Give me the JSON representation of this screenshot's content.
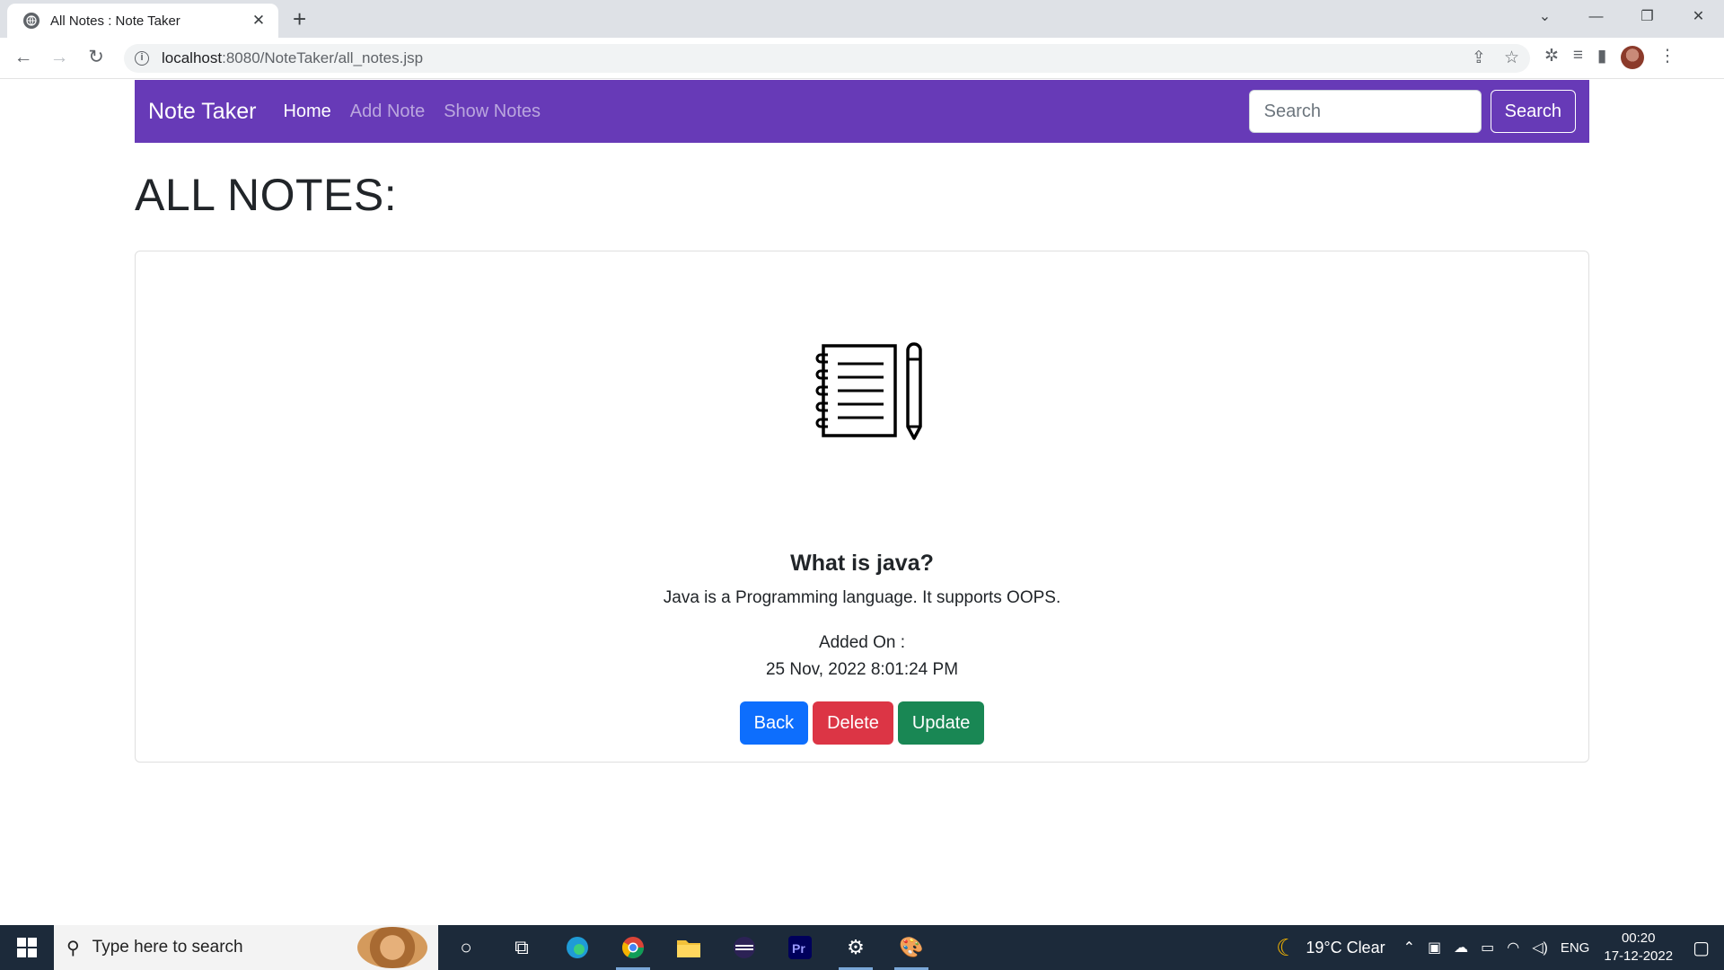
{
  "browser": {
    "tab_title": "All Notes : Note Taker",
    "tab_close": "✕",
    "new_tab": "+",
    "url_host": "localhost",
    "url_path": ":8080/NoteTaker/all_notes.jsp",
    "window_controls": [
      "⌄",
      "—",
      "❐",
      "✕"
    ]
  },
  "navbar": {
    "brand": "Note Taker",
    "links": [
      "Home",
      "Add Note",
      "Show Notes"
    ],
    "search_placeholder": "Search",
    "search_button": "Search",
    "bg_color": "#673ab7"
  },
  "page": {
    "title": "ALL NOTES:"
  },
  "note": {
    "title": "What is java?",
    "content": "Java is a Programming language. It supports OOPS.",
    "added_label": "Added On :",
    "added_date": "25 Nov, 2022 8:01:24 PM",
    "buttons": {
      "back": "Back",
      "delete": "Delete",
      "update": "Update"
    },
    "colors": {
      "back": "#0d6efd",
      "delete": "#dc3545",
      "update": "#198754"
    }
  },
  "taskbar": {
    "search_placeholder": "Type here to search",
    "weather": "19°C  Clear",
    "language": "ENG",
    "time": "00:20",
    "date": "17-12-2022"
  }
}
